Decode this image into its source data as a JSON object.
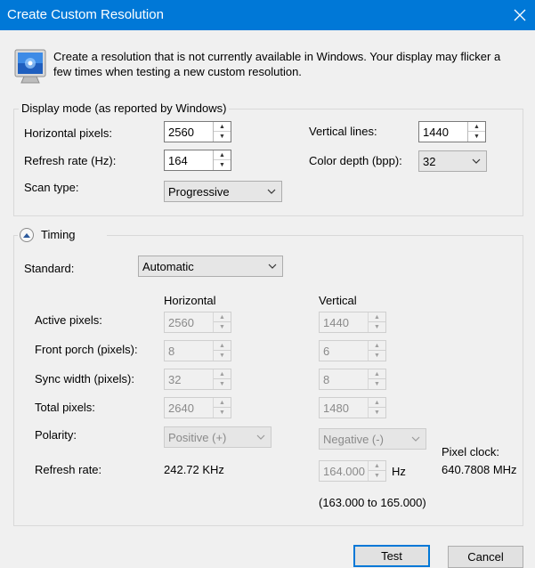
{
  "window": {
    "title": "Create Custom Resolution",
    "close_icon": "close-icon"
  },
  "intro": {
    "icon": "monitor-icon",
    "text": "Create a resolution that is not currently available in Windows. Your display may flicker a few times when testing a new custom resolution."
  },
  "display_mode": {
    "legend": "Display mode (as reported by Windows)",
    "horizontal_pixels": {
      "label": "Horizontal pixels:",
      "value": "2560"
    },
    "vertical_lines": {
      "label": "Vertical lines:",
      "value": "1440"
    },
    "refresh_rate": {
      "label": "Refresh rate (Hz):",
      "value": "164"
    },
    "color_depth": {
      "label": "Color depth (bpp):",
      "value": "32"
    },
    "scan_type": {
      "label": "Scan type:",
      "value": "Progressive"
    }
  },
  "timing": {
    "legend": "Timing",
    "standard": {
      "label": "Standard:",
      "value": "Automatic"
    },
    "col_horizontal": "Horizontal",
    "col_vertical": "Vertical",
    "rows": [
      {
        "label": "Active pixels:",
        "h": "2560",
        "v": "1440"
      },
      {
        "label": "Front porch (pixels):",
        "h": "8",
        "v": "6"
      },
      {
        "label": "Sync width (pixels):",
        "h": "32",
        "v": "8"
      },
      {
        "label": "Total pixels:",
        "h": "2640",
        "v": "1480"
      }
    ],
    "polarity": {
      "label": "Polarity:",
      "h": "Positive (+)",
      "v": "Negative (-)"
    },
    "refresh": {
      "label": "Refresh rate:",
      "h": "242.72 KHz",
      "v": "164.000",
      "unit": "Hz",
      "range": "(163.000 to 165.000)"
    },
    "pixel_clock": {
      "label": "Pixel clock:",
      "value": "640.7808 MHz"
    }
  },
  "buttons": {
    "test": "Test",
    "cancel": "Cancel"
  }
}
